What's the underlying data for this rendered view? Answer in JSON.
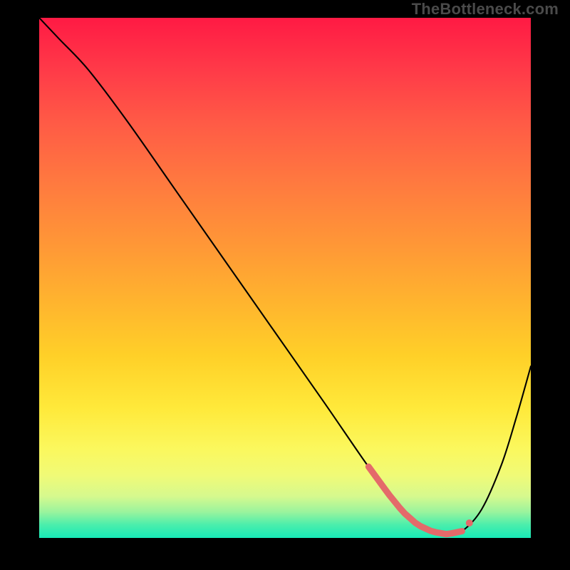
{
  "watermark": "TheBottleneck.com",
  "chart_data": {
    "type": "line",
    "title": "",
    "xlabel": "",
    "ylabel": "",
    "xlim": [
      0,
      100
    ],
    "ylim": [
      0,
      100
    ],
    "grid": false,
    "legend": false,
    "background": "rainbow-vertical-gradient",
    "series": [
      {
        "name": "bottleneck-curve",
        "color": "#000000",
        "x": [
          0,
          4,
          10,
          18,
          28,
          38,
          48,
          58,
          66,
          71,
          74,
          77,
          80,
          83,
          86,
          90,
          94,
          97,
          100
        ],
        "y": [
          100,
          96,
          90,
          80,
          66.5,
          53,
          39.5,
          26,
          15,
          8.5,
          5,
          2.5,
          1.2,
          0.7,
          1.3,
          5.5,
          14,
          23,
          33
        ]
      }
    ],
    "highlight": {
      "name": "optimal-range",
      "color": "#e46a6a",
      "x_range": [
        67,
        86
      ],
      "dot_x": 86
    },
    "colors": {
      "gradient_top": "#ff1a44",
      "gradient_mid": "#ffd028",
      "gradient_bottom": "#17eab7",
      "frame": "#000000"
    }
  }
}
